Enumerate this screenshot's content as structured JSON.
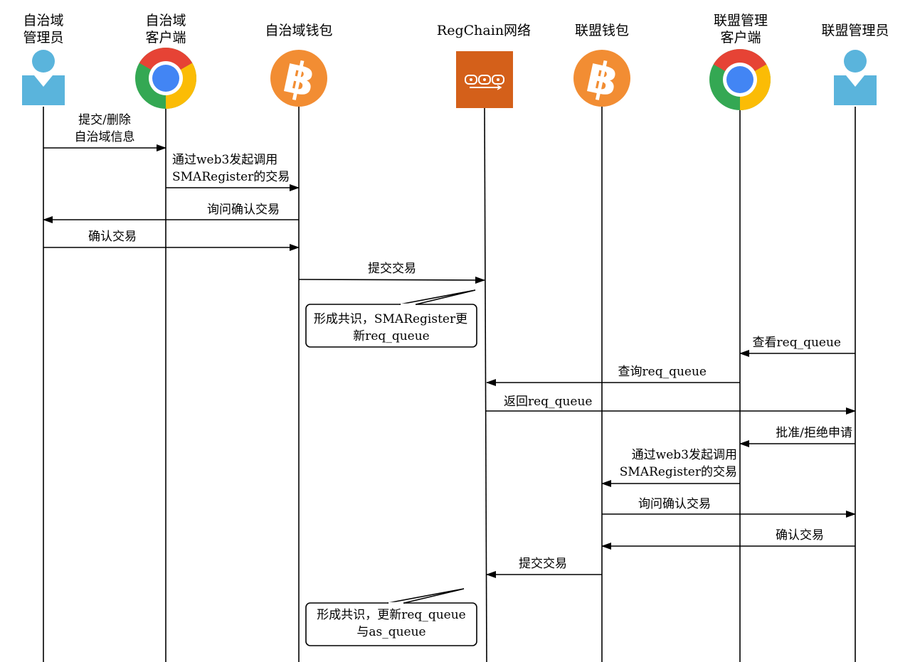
{
  "actors": [
    {
      "id": "as_admin",
      "icon": "user-icon",
      "label": [
        "自治域",
        "管理员"
      ]
    },
    {
      "id": "as_client",
      "icon": "chrome-icon",
      "label": [
        "自治域",
        "客户端"
      ]
    },
    {
      "id": "as_wallet",
      "icon": "bitcoin-icon",
      "label": [
        "自治域钱包"
      ]
    },
    {
      "id": "regchain",
      "icon": "blockchain-icon",
      "label": [
        "RegChain网络"
      ]
    },
    {
      "id": "al_wallet",
      "icon": "bitcoin-icon",
      "label": [
        "联盟钱包"
      ]
    },
    {
      "id": "al_client",
      "icon": "chrome-icon",
      "label": [
        "联盟管理",
        "客户端"
      ]
    },
    {
      "id": "al_admin",
      "icon": "user-icon",
      "label": [
        "联盟管理员"
      ]
    }
  ],
  "messages": [
    {
      "from": "as_admin",
      "to": "as_client",
      "label": [
        "提交/删除",
        "自治域信息"
      ]
    },
    {
      "from": "as_client",
      "to": "as_wallet",
      "label": [
        "通过web3发起调用",
        "SMARegister的交易"
      ]
    },
    {
      "from": "as_wallet",
      "to": "as_admin",
      "label": [
        "询问确认交易"
      ]
    },
    {
      "from": "as_admin",
      "to": "as_wallet",
      "label": [
        "确认交易"
      ]
    },
    {
      "from": "as_wallet",
      "to": "regchain",
      "label": [
        "提交交易"
      ]
    },
    {
      "from": "al_admin",
      "to": "al_client",
      "label": [
        "查看req_queue"
      ]
    },
    {
      "from": "al_client",
      "to": "regchain",
      "label": [
        "查询req_queue"
      ]
    },
    {
      "from": "regchain",
      "to": "al_admin",
      "label": [
        "返回req_queue"
      ]
    },
    {
      "from": "al_admin",
      "to": "al_client",
      "label": [
        "批准/拒绝申请"
      ]
    },
    {
      "from": "al_client",
      "to": "al_wallet",
      "label": [
        "通过web3发起调用",
        "SMARegister的交易"
      ]
    },
    {
      "from": "al_wallet",
      "to": "al_admin",
      "label": [
        "询问确认交易"
      ]
    },
    {
      "from": "al_admin",
      "to": "al_wallet",
      "label": [
        "确认交易"
      ]
    },
    {
      "from": "al_wallet",
      "to": "regchain",
      "label": [
        "提交交易"
      ]
    }
  ],
  "notes": [
    {
      "label": [
        "形成共识，SMARegister更",
        "新req_queue"
      ]
    },
    {
      "label": [
        "形成共识，更新req_queue",
        "与as_queue"
      ]
    }
  ],
  "colors": {
    "user": "#5ab4dc",
    "bitcoin": "#f28d33",
    "blockchain": "#d4601a",
    "chrome_red": "#e64335",
    "chrome_green": "#34a853",
    "chrome_yellow": "#fbbc05",
    "chrome_blue": "#4285f4"
  }
}
